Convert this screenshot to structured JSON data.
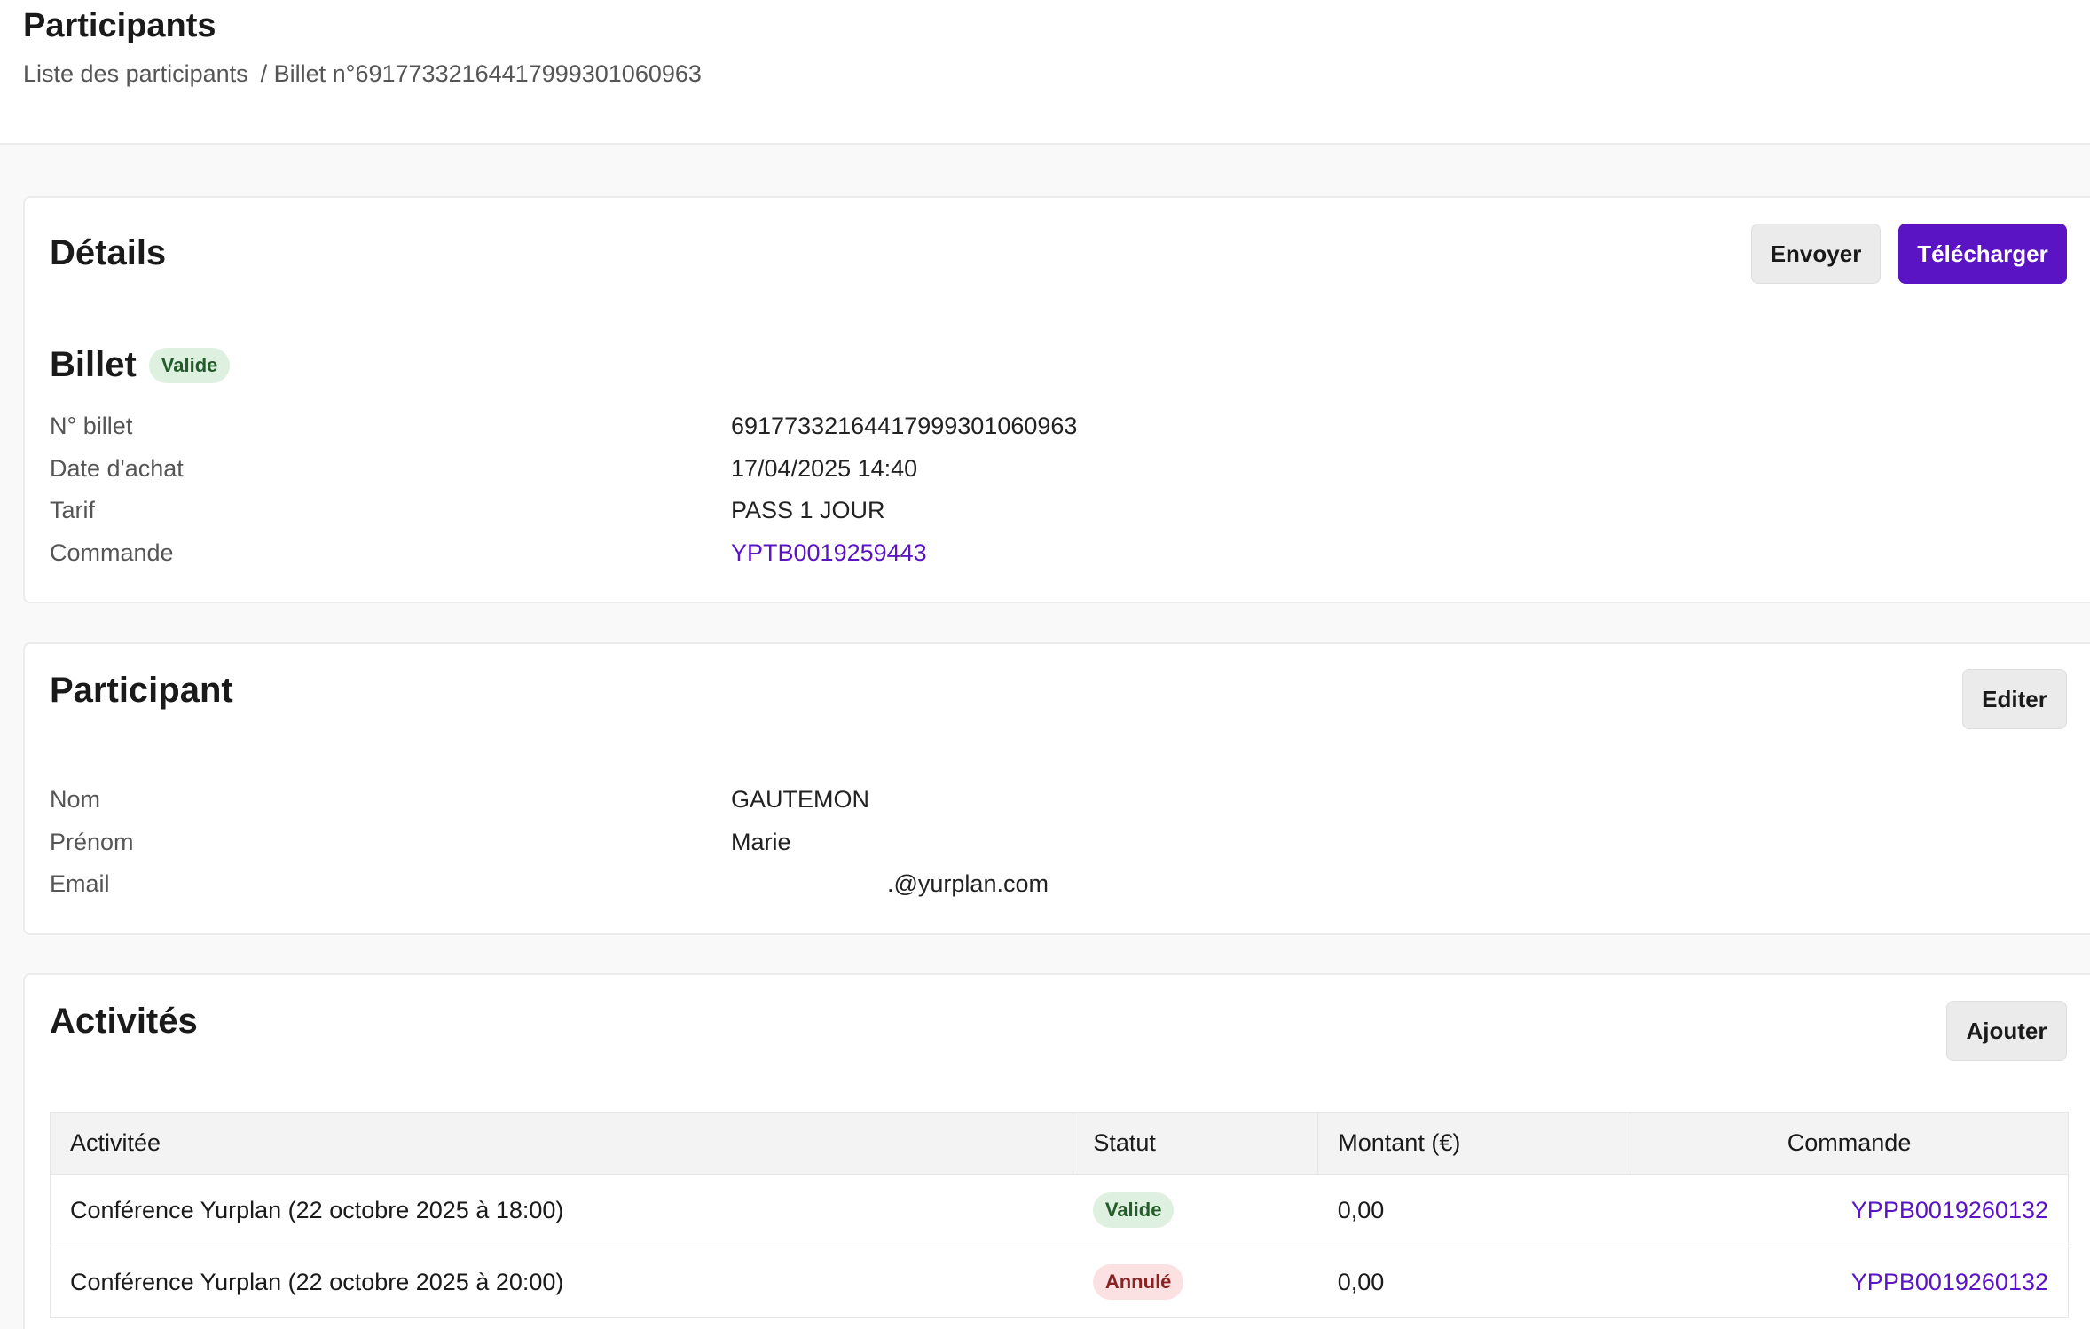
{
  "header": {
    "title": "Participants",
    "breadcrumb_root": "Liste des participants",
    "breadcrumb_current": "/ Billet n°69177332164417999301060963"
  },
  "details": {
    "title": "Détails",
    "send_label": "Envoyer",
    "download_label": "Télécharger",
    "ticket_title": "Billet",
    "ticket_status": "Valide",
    "fields": [
      {
        "label": "N° billet",
        "value": "69177332164417999301060963"
      },
      {
        "label": "Date d'achat",
        "value": "17/04/2025 14:40"
      },
      {
        "label": "Tarif",
        "value": "PASS 1 JOUR"
      },
      {
        "label": "Commande",
        "value": "YPTB0019259443"
      }
    ]
  },
  "participant": {
    "title": "Participant",
    "edit_label": "Editer",
    "fields": [
      {
        "label": "Nom",
        "value": "GAUTEMON"
      },
      {
        "label": "Prénom",
        "value": "Marie"
      },
      {
        "label": "Email",
        "value": ".@yurplan.com"
      }
    ]
  },
  "activities": {
    "title": "Activités",
    "add_label": "Ajouter",
    "columns": [
      "Activitée",
      "Statut",
      "Montant (€)",
      "Commande"
    ],
    "rows": [
      {
        "activity": "Conférence Yurplan (22 octobre 2025 à 18:00)",
        "status": "Valide",
        "amount": "0,00",
        "order": "YPPB0019260132"
      },
      {
        "activity": "Conférence Yurplan (22 octobre 2025 à 20:00)",
        "status": "Annulé",
        "amount": "0,00",
        "order": "YPPB0019260132"
      }
    ]
  },
  "colors": {
    "primary": "#5b14c4",
    "valid_bg": "#def0df",
    "cancel_bg": "#fbe1e1"
  }
}
